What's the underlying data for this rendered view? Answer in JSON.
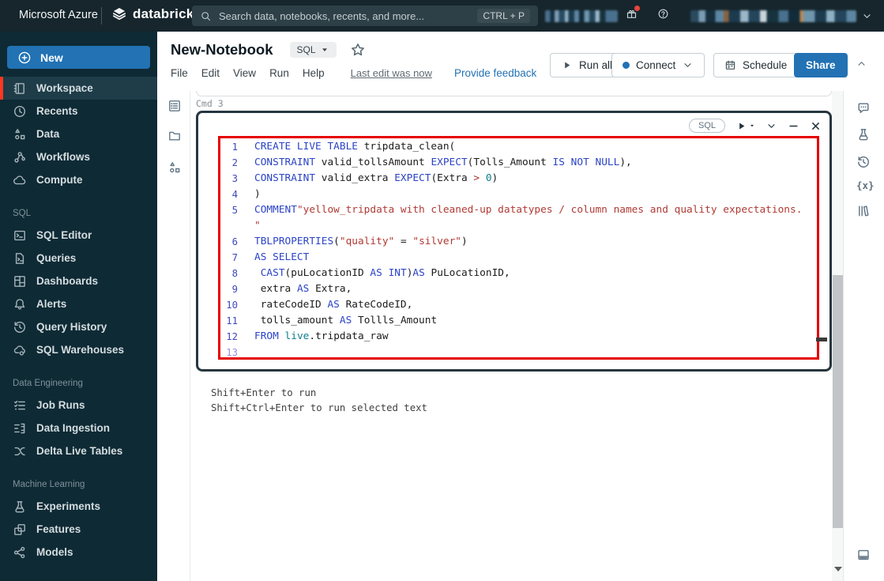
{
  "topbar": {
    "brand": "Microsoft Azure",
    "product": "databricks",
    "search": {
      "placeholder": "Search data, notebooks, recents, and more...",
      "shortcut": "CTRL + P"
    },
    "right_icons": [
      "gift-icon",
      "help-icon",
      "chevron-down-icon"
    ]
  },
  "sidebar": {
    "new_button": "New",
    "sections": [
      {
        "label": "",
        "items": [
          {
            "icon": "workspace-icon",
            "label": "Workspace",
            "active": true
          },
          {
            "icon": "recents-icon",
            "label": "Recents"
          },
          {
            "icon": "data-icon",
            "label": "Data"
          },
          {
            "icon": "workflows-icon",
            "label": "Workflows"
          },
          {
            "icon": "compute-icon",
            "label": "Compute"
          }
        ]
      },
      {
        "label": "SQL",
        "items": [
          {
            "icon": "sql-editor-icon",
            "label": "SQL Editor"
          },
          {
            "icon": "queries-icon",
            "label": "Queries"
          },
          {
            "icon": "dashboards-icon",
            "label": "Dashboards"
          },
          {
            "icon": "alerts-icon",
            "label": "Alerts"
          },
          {
            "icon": "query-history-icon",
            "label": "Query History"
          },
          {
            "icon": "sql-warehouses-icon",
            "label": "SQL Warehouses"
          }
        ]
      },
      {
        "label": "Data Engineering",
        "items": [
          {
            "icon": "job-runs-icon",
            "label": "Job Runs"
          },
          {
            "icon": "data-ingestion-icon",
            "label": "Data Ingestion"
          },
          {
            "icon": "delta-live-tables-icon",
            "label": "Delta Live Tables"
          }
        ]
      },
      {
        "label": "Machine Learning",
        "items": [
          {
            "icon": "experiments-icon",
            "label": "Experiments"
          },
          {
            "icon": "features-icon",
            "label": "Features"
          },
          {
            "icon": "models-icon",
            "label": "Models"
          }
        ]
      }
    ]
  },
  "notebook_header": {
    "title": "New-Notebook",
    "language": "SQL",
    "menu": [
      "File",
      "Edit",
      "View",
      "Run",
      "Help"
    ],
    "last_edit": "Last edit was now",
    "feedback_link": "Provide feedback",
    "run_all": "Run all",
    "connect": "Connect",
    "schedule": "Schedule",
    "share": "Share"
  },
  "editor": {
    "cmd_label": "Cmd 3",
    "gutter_icons": [
      "toc-icon",
      "folder-icon",
      "lineage-icon"
    ],
    "cell_toolbar": {
      "language_badge": "SQL",
      "icons": [
        "run-cell-icon",
        "chevron-down-icon",
        "minimize-icon",
        "close-icon"
      ]
    },
    "hints": [
      "Shift+Enter to run",
      "Shift+Ctrl+Enter to run selected text"
    ],
    "code": {
      "cursor_line": "13",
      "token_colors": {
        "kw": "#2b43c6",
        "str": "#b03a34",
        "num": "#0e7d8c",
        "var": "#0e7d8c",
        "op": "#a8322f",
        "pl": "#1c1c1c"
      },
      "line_number_color": "#4049b8",
      "cursor_line_number_color": "#9a8fe0",
      "lines": [
        {
          "n": "1",
          "tokens": [
            {
              "c": "kw",
              "t": "CREATE LIVE TABLE"
            },
            {
              "c": "pl",
              "t": " tripdata_clean("
            }
          ]
        },
        {
          "n": "2",
          "tokens": [
            {
              "c": "kw",
              "t": "CONSTRAINT"
            },
            {
              "c": "pl",
              "t": " valid_tollsAmount "
            },
            {
              "c": "kw",
              "t": "EXPECT"
            },
            {
              "c": "pl",
              "t": "(Tolls_Amount "
            },
            {
              "c": "kw",
              "t": "IS NOT"
            },
            {
              "c": "pl",
              "t": " "
            },
            {
              "c": "kw",
              "t": "NULL"
            },
            {
              "c": "pl",
              "t": "),"
            }
          ]
        },
        {
          "n": "3",
          "tokens": [
            {
              "c": "kw",
              "t": "CONSTRAINT"
            },
            {
              "c": "pl",
              "t": " valid_extra "
            },
            {
              "c": "kw",
              "t": "EXPECT"
            },
            {
              "c": "pl",
              "t": "(Extra "
            },
            {
              "c": "op",
              "t": ">"
            },
            {
              "c": "pl",
              "t": " "
            },
            {
              "c": "num",
              "t": "0"
            },
            {
              "c": "pl",
              "t": ")"
            }
          ]
        },
        {
          "n": "4",
          "tokens": [
            {
              "c": "pl",
              "t": ")"
            }
          ]
        },
        {
          "n": "5",
          "tokens": [
            {
              "c": "kw",
              "t": "COMMENT"
            },
            {
              "c": "str",
              "t": "\"yellow_tripdata with cleaned-up datatypes / column names and quality expectations."
            }
          ]
        },
        {
          "n": "",
          "tokens": [
            {
              "c": "str",
              "t": "\""
            }
          ]
        },
        {
          "n": "6",
          "tokens": [
            {
              "c": "kw",
              "t": "TBLPROPERTIES"
            },
            {
              "c": "pl",
              "t": "("
            },
            {
              "c": "str",
              "t": "\"quality\""
            },
            {
              "c": "pl",
              "t": " = "
            },
            {
              "c": "str",
              "t": "\"silver\""
            },
            {
              "c": "pl",
              "t": ")"
            }
          ]
        },
        {
          "n": "7",
          "tokens": [
            {
              "c": "kw",
              "t": "AS SELECT"
            }
          ]
        },
        {
          "n": "8",
          "tokens": [
            {
              "c": "pl",
              "t": " "
            },
            {
              "c": "kw",
              "t": "CAST"
            },
            {
              "c": "pl",
              "t": "(puLocationID "
            },
            {
              "c": "kw",
              "t": "AS"
            },
            {
              "c": "pl",
              "t": " "
            },
            {
              "c": "kw",
              "t": "INT"
            },
            {
              "c": "pl",
              "t": ")"
            },
            {
              "c": "kw",
              "t": "AS"
            },
            {
              "c": "pl",
              "t": " PuLocationID,"
            }
          ]
        },
        {
          "n": "9",
          "tokens": [
            {
              "c": "pl",
              "t": " extra "
            },
            {
              "c": "kw",
              "t": "AS"
            },
            {
              "c": "pl",
              "t": " Extra,"
            }
          ]
        },
        {
          "n": "10",
          "tokens": [
            {
              "c": "pl",
              "t": " rateCodeID "
            },
            {
              "c": "kw",
              "t": "AS"
            },
            {
              "c": "pl",
              "t": " RateCodeID,"
            }
          ]
        },
        {
          "n": "11",
          "tokens": [
            {
              "c": "pl",
              "t": " tolls_amount "
            },
            {
              "c": "kw",
              "t": "AS"
            },
            {
              "c": "pl",
              "t": " Tollls_Amount"
            }
          ]
        },
        {
          "n": "12",
          "tokens": [
            {
              "c": "kw",
              "t": "FROM"
            },
            {
              "c": "pl",
              "t": " "
            },
            {
              "c": "var",
              "t": "live"
            },
            {
              "c": "pl",
              "t": ".tripdata_raw"
            }
          ]
        },
        {
          "n": "13",
          "tokens": []
        }
      ]
    }
  },
  "right_rail": {
    "icons": [
      "comment-icon",
      "experiment-icon",
      "history-icon",
      "variables-icon",
      "library-icon"
    ],
    "bottom_icon": "panel-bottom-icon"
  },
  "colors": {
    "accent_blue": "#2272b4",
    "sidebar_active_red": "#ff3621",
    "annotation_red": "#e60000",
    "topbar_bg": "#16262c",
    "sidebar_bg": "#0e2a35"
  }
}
